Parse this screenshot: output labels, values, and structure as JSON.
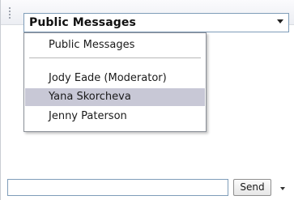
{
  "combo": {
    "selected_label": "Public Messages"
  },
  "dropdown": {
    "items": [
      {
        "label": "Public Messages"
      },
      {
        "label": "Jody Eade (Moderator)"
      },
      {
        "label": "Yana Skorcheva"
      },
      {
        "label": "Jenny Paterson"
      }
    ],
    "highlighted_item": "Yana Skorcheva"
  },
  "composer": {
    "input_value": "",
    "send_label": "Send"
  },
  "colors": {
    "highlight": "#c8c8d6",
    "input_border": "#7f9db9"
  },
  "icons": {
    "combo_arrow": "chevron-down-icon",
    "send_options": "chevron-down-icon",
    "toolbar_grip": "grip-icon"
  }
}
